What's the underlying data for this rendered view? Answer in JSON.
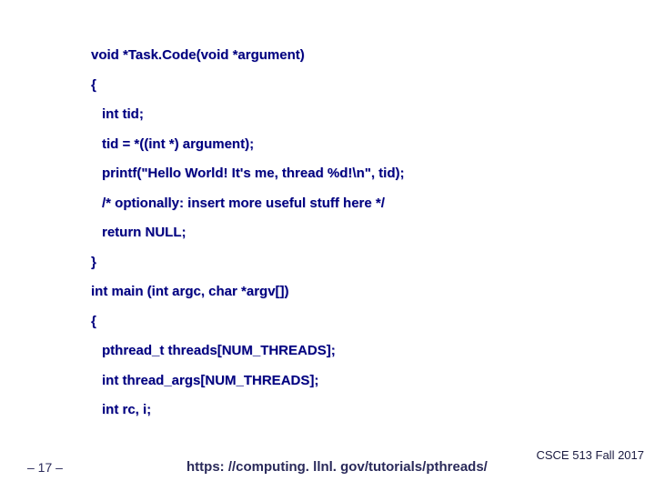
{
  "code": {
    "l1": "void *Task.Code(void *argument)",
    "l2": "{",
    "l3": "int tid;",
    "l4": "tid = *((int *) argument);",
    "l5": "printf(\"Hello World! It's me, thread %d!\\n\", tid);",
    "l6": "/* optionally: insert more useful stuff here */",
    "l7": "return NULL;",
    "l8": "}",
    "l9": "int main (int argc, char *argv[])",
    "l10": "{",
    "l11": "pthread_t threads[NUM_THREADS];",
    "l12": "int thread_args[NUM_THREADS];",
    "l13": "int rc, i;"
  },
  "footer": {
    "page": "– 17 –",
    "url": "https: //computing. llnl. gov/tutorials/pthreads/",
    "course": "CSCE 513 Fall 2017"
  }
}
